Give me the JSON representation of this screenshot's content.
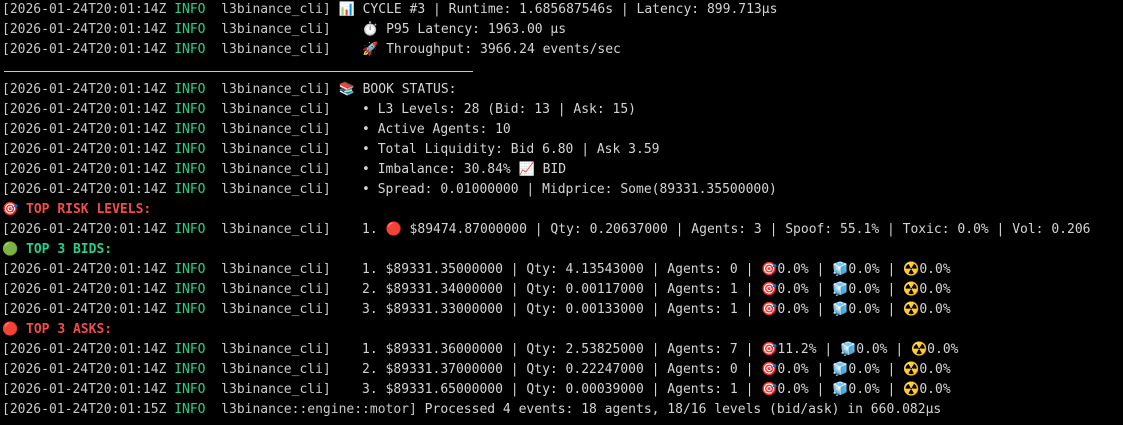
{
  "colors": {
    "background": "#000000",
    "info": "#23d18b",
    "text": "#d4d4d4",
    "section_red": "#f14c4c",
    "section_green": "#23d18b"
  },
  "icons": {
    "chart": "bar-chart-icon",
    "stopwatch": "stopwatch-icon",
    "rocket": "rocket-icon",
    "books": "books-icon",
    "trend": "chart-increasing-icon",
    "target": "direct-hit-icon",
    "red_dot": "red-circle-icon",
    "green_dot": "green-circle-icon",
    "ice": "ice-cube-icon",
    "radioactive": "radioactive-icon"
  },
  "lines": [
    {
      "ts": "[2026-01-24T20:01:14Z",
      "lvl": "INFO",
      "tgt": "l3binance_cli]",
      "msg": " 📊 CYCLE #3 | Runtime: 1.685687546s | Latency: 899.713µs"
    },
    {
      "ts": "[2026-01-24T20:01:14Z",
      "lvl": "INFO",
      "tgt": "l3binance_cli]",
      "msg": "    ⏱️ P95 Latency: 1963.00 µs"
    },
    {
      "ts": "[2026-01-24T20:01:14Z",
      "lvl": "INFO",
      "tgt": "l3binance_cli]",
      "msg": "    🚀 Throughput: 3966.24 events/sec"
    },
    {
      "separator": true
    },
    {
      "ts": "[2026-01-24T20:01:14Z",
      "lvl": "INFO",
      "tgt": "l3binance_cli]",
      "msg": " 📚 BOOK STATUS:"
    },
    {
      "ts": "[2026-01-24T20:01:14Z",
      "lvl": "INFO",
      "tgt": "l3binance_cli]",
      "msg": "    • L3 Levels: 28 (Bid: 13 | Ask: 15)"
    },
    {
      "ts": "[2026-01-24T20:01:14Z",
      "lvl": "INFO",
      "tgt": "l3binance_cli]",
      "msg": "    • Active Agents: 10"
    },
    {
      "ts": "[2026-01-24T20:01:14Z",
      "lvl": "INFO",
      "tgt": "l3binance_cli]",
      "msg": "    • Total Liquidity: Bid 6.80 | Ask 3.59"
    },
    {
      "ts": "[2026-01-24T20:01:14Z",
      "lvl": "INFO",
      "tgt": "l3binance_cli]",
      "msg": "    • Imbalance: 30.84% 📈 BID"
    },
    {
      "ts": "[2026-01-24T20:01:14Z",
      "lvl": "INFO",
      "tgt": "l3binance_cli]",
      "msg": "    • Spread: 0.01000000 | Midprice: Some(89331.35500000)"
    },
    {
      "header": "🎯 TOP RISK LEVELS:",
      "color": "red"
    },
    {
      "ts": "[2026-01-24T20:01:14Z",
      "lvl": "INFO",
      "tgt": "l3binance_cli]",
      "msg": "    1. 🔴 $89474.87000000 | Qty: 0.20637000 | Agents: 3 | Spoof: 55.1% | Toxic: 0.0% | Vol: 0.206"
    },
    {
      "header": "🟢 TOP 3 BIDS:",
      "color": "green"
    },
    {
      "ts": "[2026-01-24T20:01:14Z",
      "lvl": "INFO",
      "tgt": "l3binance_cli]",
      "msg": "    1. $89331.35000000 | Qty: 4.13543000 | Agents: 0 | 🎯0.0% | 🧊0.0% | ☢️0.0%"
    },
    {
      "ts": "[2026-01-24T20:01:14Z",
      "lvl": "INFO",
      "tgt": "l3binance_cli]",
      "msg": "    2. $89331.34000000 | Qty: 0.00117000 | Agents: 1 | 🎯0.0% | 🧊0.0% | ☢️0.0%"
    },
    {
      "ts": "[2026-01-24T20:01:14Z",
      "lvl": "INFO",
      "tgt": "l3binance_cli]",
      "msg": "    3. $89331.33000000 | Qty: 0.00133000 | Agents: 1 | 🎯0.0% | 🧊0.0% | ☢️0.0%"
    },
    {
      "header": "🔴 TOP 3 ASKS:",
      "color": "red"
    },
    {
      "ts": "[2026-01-24T20:01:14Z",
      "lvl": "INFO",
      "tgt": "l3binance_cli]",
      "msg": "    1. $89331.36000000 | Qty: 2.53825000 | Agents: 7 | 🎯11.2% | 🧊0.0% | ☢️0.0%"
    },
    {
      "ts": "[2026-01-24T20:01:14Z",
      "lvl": "INFO",
      "tgt": "l3binance_cli]",
      "msg": "    2. $89331.37000000 | Qty: 0.22247000 | Agents: 0 | 🎯0.0% | 🧊0.0% | ☢️0.0%"
    },
    {
      "ts": "[2026-01-24T20:01:14Z",
      "lvl": "INFO",
      "tgt": "l3binance_cli]",
      "msg": "    3. $89331.65000000 | Qty: 0.00039000 | Agents: 1 | 🎯0.0% | 🧊0.0% | ☢️0.0%"
    },
    {
      "ts": "[2026-01-24T20:01:15Z",
      "lvl": "INFO",
      "tgt": "l3binance::engine::motor]",
      "msg": " Processed 4 events: 18 agents, 18/16 levels (bid/ask) in 660.082µs"
    }
  ]
}
